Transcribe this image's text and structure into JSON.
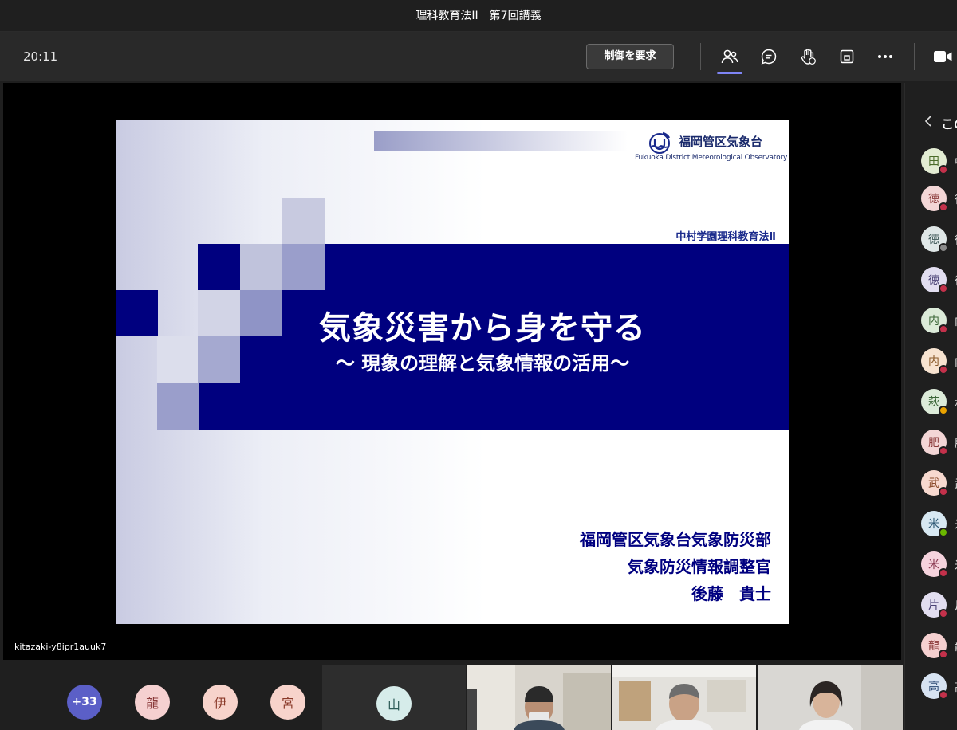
{
  "window": {
    "title": "理科教育法II　第7回講義"
  },
  "toolbar": {
    "clock": "20:11",
    "request_control_label": "制御を要求",
    "icons": [
      "participants-icon",
      "chat-icon",
      "raise-hand-icon",
      "share-screen-icon",
      "more-icon",
      "camera-icon"
    ]
  },
  "slide": {
    "org_name": "福岡管区気象台",
    "org_name_en": "Fukuoka District Meteorological Observatory",
    "course": "中村学園理科教育法Ⅱ",
    "title": "気象災害から身を守る",
    "subtitle": "～ 現象の理解と気象情報の活用～",
    "affiliation_1": "福岡管区気象台気象防災部",
    "affiliation_2": "気象防災情報調整官",
    "presenter": "後藤　貴士"
  },
  "presenter_label": "kitazaki-y8ipr1auuk7",
  "gallery": {
    "overflow_count": "+33",
    "avatars": [
      {
        "initial": "龍",
        "bg": "#f5d0d0",
        "fg": "#8a3a3a"
      },
      {
        "initial": "伊",
        "bg": "#f7d3cb",
        "fg": "#8a3a2a"
      },
      {
        "initial": "宮",
        "bg": "#f7d3cb",
        "fg": "#8a3a2a"
      }
    ],
    "tile_avatar": {
      "initial": "山",
      "bg": "#d6ecea",
      "fg": "#2d5c58"
    }
  },
  "panel": {
    "header": "この",
    "participants": [
      {
        "initial": "田",
        "bg": "#e3ecd3",
        "fg": "#4b6b2a",
        "name_frag": "中",
        "status": "#c4314b"
      },
      {
        "initial": "徳",
        "bg": "#f3d6d6",
        "fg": "#8a3a3a",
        "name_frag": "徳",
        "status": "#c4314b"
      },
      {
        "initial": "徳",
        "bg": "#dfe7e7",
        "fg": "#3c5656",
        "name_frag": "徳",
        "status": "#8a8a8a"
      },
      {
        "initial": "徳",
        "bg": "#e2def0",
        "fg": "#4a4275",
        "name_frag": "徳",
        "status": "#c4314b"
      },
      {
        "initial": "内",
        "bg": "#dcebd9",
        "fg": "#3b6638",
        "name_frag": "内",
        "status": "#c4314b"
      },
      {
        "initial": "内",
        "bg": "#f7e3d0",
        "fg": "#8a5a2a",
        "name_frag": "内",
        "status": "#c4314b"
      },
      {
        "initial": "萩",
        "bg": "#dcebd9",
        "fg": "#3b6638",
        "name_frag": "萩",
        "status": "#eaa300"
      },
      {
        "initial": "肥",
        "bg": "#f3d6d6",
        "fg": "#8a3a3a",
        "name_frag": "肥",
        "status": "#c4314b"
      },
      {
        "initial": "武",
        "bg": "#f7d9cf",
        "fg": "#8a4a2a",
        "name_frag": "武",
        "status": "#c4314b"
      },
      {
        "initial": "米",
        "bg": "#d7e8f2",
        "fg": "#2c5874",
        "name_frag": "米",
        "status": "#6bb700"
      },
      {
        "initial": "米",
        "bg": "#f5d3dd",
        "fg": "#8a3a52",
        "name_frag": "米",
        "status": "#c4314b"
      },
      {
        "initial": "片",
        "bg": "#e2def0",
        "fg": "#4a4275",
        "name_frag": "片",
        "status": "#c4314b"
      },
      {
        "initial": "龍",
        "bg": "#f5d0d0",
        "fg": "#8a3a3a",
        "name_frag": "龍",
        "status": "#c4314b"
      },
      {
        "initial": "高",
        "bg": "#d7e3f2",
        "fg": "#2c4a74",
        "name_frag": "高",
        "status": "#c4314b"
      }
    ]
  },
  "colors": {
    "accent": "#7f85f5",
    "busy": "#c4314b",
    "slide_band": "#00007f"
  }
}
